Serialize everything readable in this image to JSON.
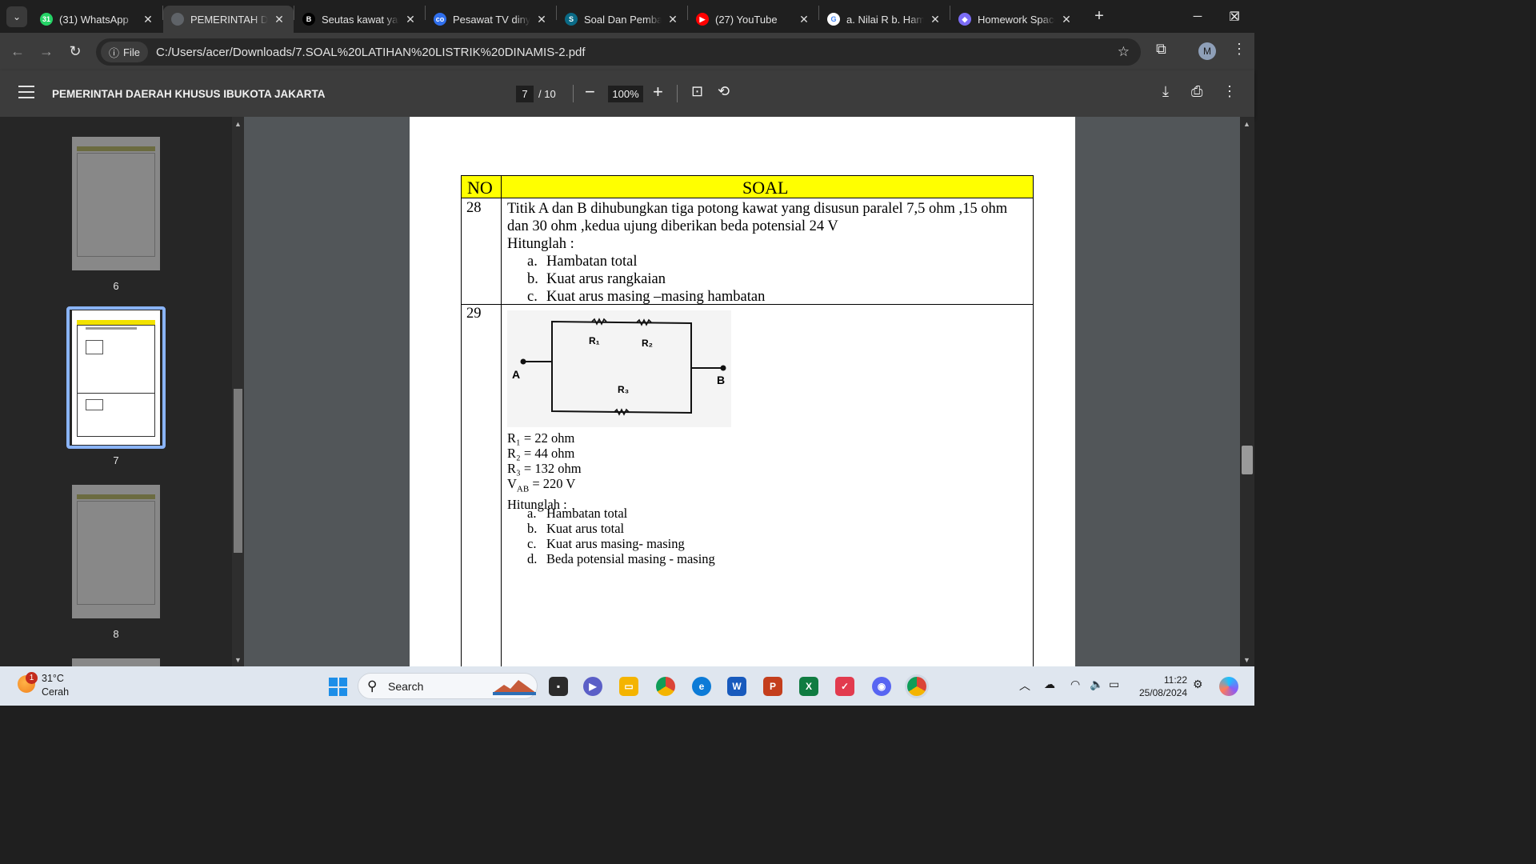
{
  "browser": {
    "tabs": [
      {
        "title": "(31) WhatsApp",
        "favicon": "whatsapp-icon",
        "color": "#25d366",
        "glyph": "31",
        "active": false
      },
      {
        "title": "PEMERINTAH DAERAH KHUSUS IBUKOTA JAKARTA",
        "favicon": "globe-icon",
        "color": "#5f6368",
        "glyph": "",
        "active": true
      },
      {
        "title": "Seutas kawat yang",
        "favicon": "brainly-icon",
        "color": "#000000",
        "glyph": "B",
        "active": false
      },
      {
        "title": "Pesawat TV dinyalakan",
        "favicon": "colearn-icon",
        "color": "#2f6fed",
        "glyph": "co",
        "active": false
      },
      {
        "title": "Soal Dan Pembahasan",
        "favicon": "s-icon",
        "color": "#0a6a86",
        "glyph": "S",
        "active": false
      },
      {
        "title": "(27) YouTube",
        "favicon": "youtube-icon",
        "color": "#ff0000",
        "glyph": "▶",
        "active": false
      },
      {
        "title": "a. Nilai R b. Hambatan",
        "favicon": "google-icon",
        "color": "#ffffff",
        "glyph": "G",
        "active": false
      },
      {
        "title": "Homework Space",
        "favicon": "homework-icon",
        "color": "#7b6cf6",
        "glyph": "◆",
        "active": false
      }
    ],
    "file_label": "File",
    "url": "C:/Users/acer/Downloads/7.SOAL%20LATIHAN%20LISTRIK%20DINAMIS-2.pdf",
    "profile_initial": "M"
  },
  "pdf": {
    "title": "PEMERINTAH DAERAH KHUSUS IBUKOTA JAKARTA",
    "current_page": "7",
    "total_pages": "/ 10",
    "zoom": "100%",
    "thumbnails": [
      "6",
      "7",
      "8"
    ],
    "table": {
      "col_no": "NO",
      "col_soal": "SOAL",
      "q28": {
        "no": "28",
        "text": "Titik A dan B dihubungkan tiga potong kawat yang disusun paralel 7,5 ohm ,15 ohm dan 30 ohm ,kedua ujung diberikan beda potensial 24 V",
        "prompt": "Hitunglah :",
        "items": [
          {
            "mark": "a.",
            "text": "Hambatan total"
          },
          {
            "mark": "b.",
            "text": "Kuat arus rangkaian"
          },
          {
            "mark": "c.",
            "text": "Kuat arus masing –masing hambatan"
          }
        ]
      },
      "q29": {
        "no": "29",
        "diagram": {
          "r1": "R₁",
          "r2": "R₂",
          "r3": "R₃",
          "a": "A",
          "b": "B"
        },
        "values": [
          "R₁ = 22 ohm",
          "R₂ = 44 ohm",
          "R₃ = 132 ohm"
        ],
        "vab": {
          "label": "V",
          "sub": "AB",
          "value": " = 220 V"
        },
        "prompt": "Hitunglah :",
        "items": [
          {
            "mark": "a.",
            "text": "Hambatan total"
          },
          {
            "mark": "b.",
            "text": "Kuat arus total"
          },
          {
            "mark": "c.",
            "text": "Kuat arus  masing- masing"
          },
          {
            "mark": "d.",
            "text": "Beda potensial masing - masing"
          }
        ]
      }
    }
  },
  "taskbar": {
    "weather_badge": "1",
    "temperature": "31°C",
    "condition": "Cerah",
    "search_placeholder": "Search",
    "time": "11:22",
    "date": "25/08/2024"
  }
}
